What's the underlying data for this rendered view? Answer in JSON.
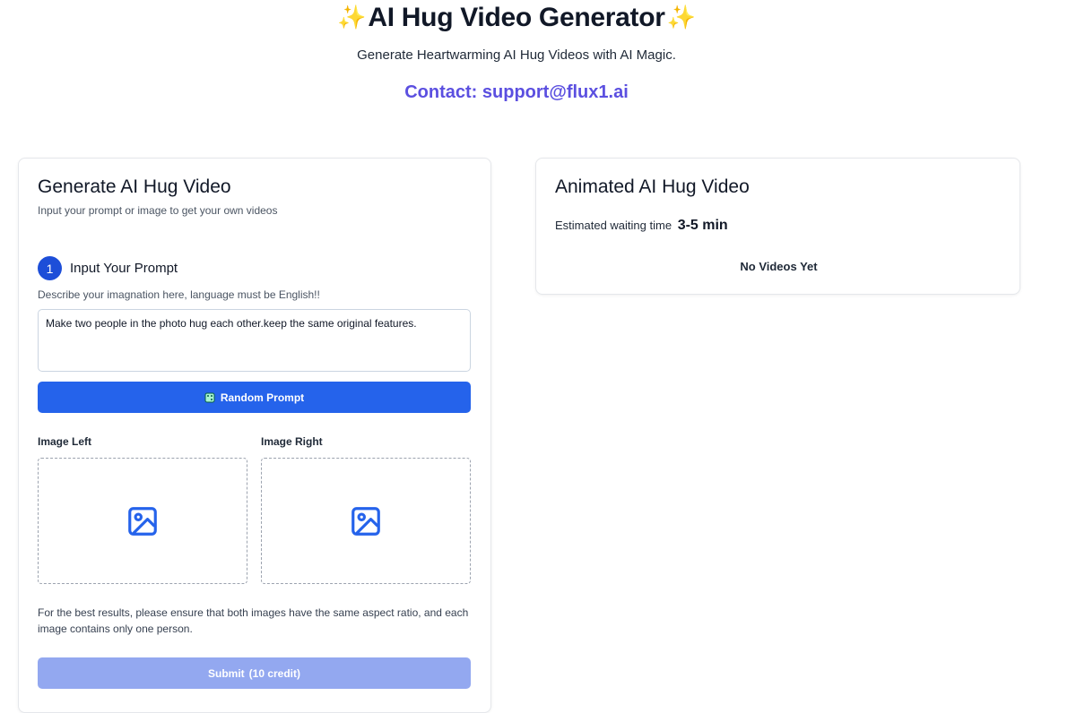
{
  "header": {
    "sparkle_left": "✨",
    "title": "AI Hug Video Generator",
    "sparkle_right": "✨",
    "subtitle": "Generate Heartwarming AI Hug Videos with AI Magic.",
    "contact": "Contact: support@flux1.ai"
  },
  "generator": {
    "title": "Generate AI Hug Video",
    "subtitle": "Input your prompt or image to get your own videos",
    "step_number": "1",
    "step_label": "Input Your Prompt",
    "prompt_hint": "Describe your imagnation here, language must be English!!",
    "prompt_value": "Make two people in the photo hug each other.keep the same original features.",
    "random_button": "Random Prompt",
    "image_left_label": "Image Left",
    "image_right_label": "Image Right",
    "note": "For the best results, please ensure that both images have the same aspect ratio, and each image contains only one person.",
    "submit_label": "Submit",
    "submit_credit": "(10 credit)"
  },
  "output": {
    "title": "Animated AI Hug Video",
    "wait_label": "Estimated waiting time",
    "wait_value": "3-5 min",
    "empty_text": "No Videos Yet"
  },
  "colors": {
    "primary": "#2563eb",
    "primary_disabled": "#93a8f0",
    "contact": "#5b4fe0",
    "step_badge": "#1d4ed8"
  },
  "icons": {
    "dropzone": "image-icon",
    "random": "dice-icon",
    "sparkle": "sparkle-icon"
  }
}
